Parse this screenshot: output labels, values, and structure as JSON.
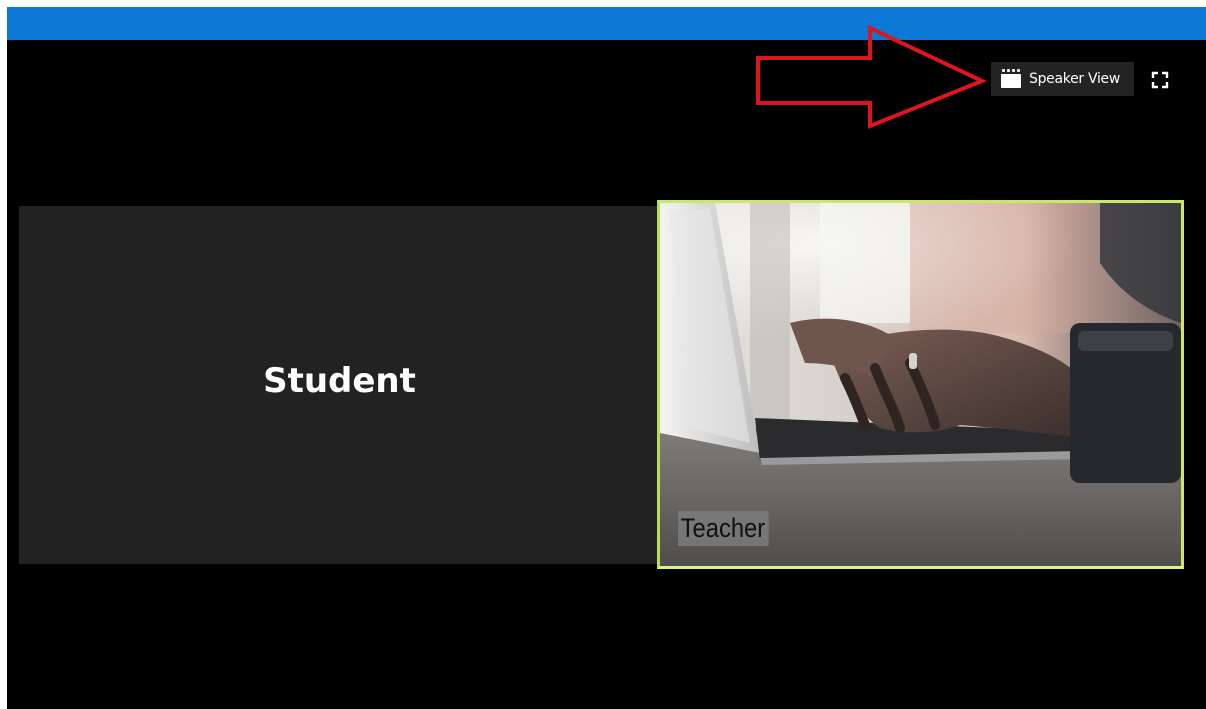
{
  "toolbar": {
    "speaker_view_label": "Speaker View",
    "speaker_view_icon": "speaker-view-icon",
    "fullscreen_icon": "fullscreen-icon"
  },
  "participants": [
    {
      "name": "Student",
      "video": false
    },
    {
      "name": "Teacher",
      "video": true,
      "active_speaker": true
    }
  ],
  "colors": {
    "titlebar": "#0a78d4",
    "background": "#000000",
    "tile_background": "#222222",
    "active_speaker_border": "#c9e86b",
    "annotation_arrow": "#e0141e"
  }
}
